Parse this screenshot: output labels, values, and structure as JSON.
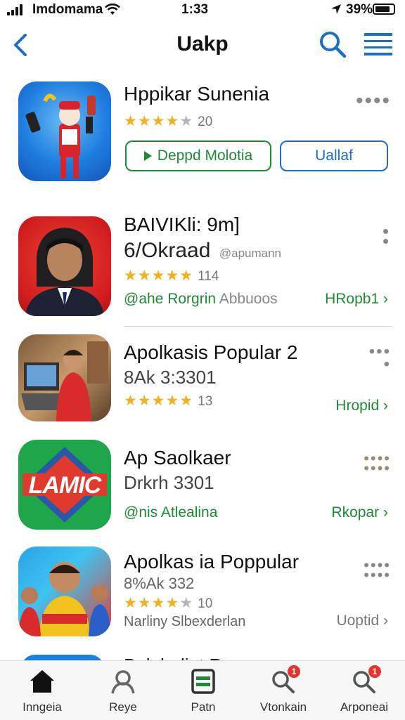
{
  "status_bar": {
    "carrier": "Imdomama",
    "time": "1:33",
    "battery": "39%"
  },
  "nav": {
    "title": "Uakp",
    "back_icon": "chevron-left-icon",
    "search_icon": "search-icon",
    "menu_icon": "menu-icon",
    "accent": "#1a6fc8"
  },
  "apps": [
    {
      "name": "Hppikar Sunenia",
      "stars": 3.5,
      "rating_count": "20",
      "primary_button": "Deppd Molotia",
      "secondary_button": "Uallaf"
    },
    {
      "name": "BAIVIKli: 9m]",
      "subtitle": "6/Okraad",
      "subtitle_small": "@apumann",
      "stars": 5,
      "rating_count": "114",
      "developer": "@ahe Rorgrin",
      "developer_extra": "Abbuoos",
      "action": "HRopb1"
    },
    {
      "name": "Apolkasis Popular 2",
      "subtitle": "8Ak 3:3301",
      "stars": 5,
      "rating_count": "13",
      "action": "Hropid"
    },
    {
      "name": "Ap Saolkaer",
      "subtitle": "Drkrh 3301",
      "developer": "@nis Atlealina",
      "action": "Rkopar",
      "icon_text": "LAMIC"
    },
    {
      "name": "Apolkas ia Poppular",
      "subtitle": "8%Ak 332",
      "stars": 4,
      "rating_count": "10",
      "developer": "Narliny Slbexderlan",
      "action": "Uoptid"
    }
  ],
  "partial_row_text": "Baluhaliat R",
  "tabs": [
    {
      "label": "Inngeia",
      "icon": "home-icon"
    },
    {
      "label": "Reye",
      "icon": "person-icon"
    },
    {
      "label": "Patn",
      "icon": "apps-icon"
    },
    {
      "label": "Vtonkain",
      "icon": "search-icon",
      "badge": "1"
    },
    {
      "label": "Arponeai",
      "icon": "search-icon",
      "badge": "1"
    }
  ]
}
